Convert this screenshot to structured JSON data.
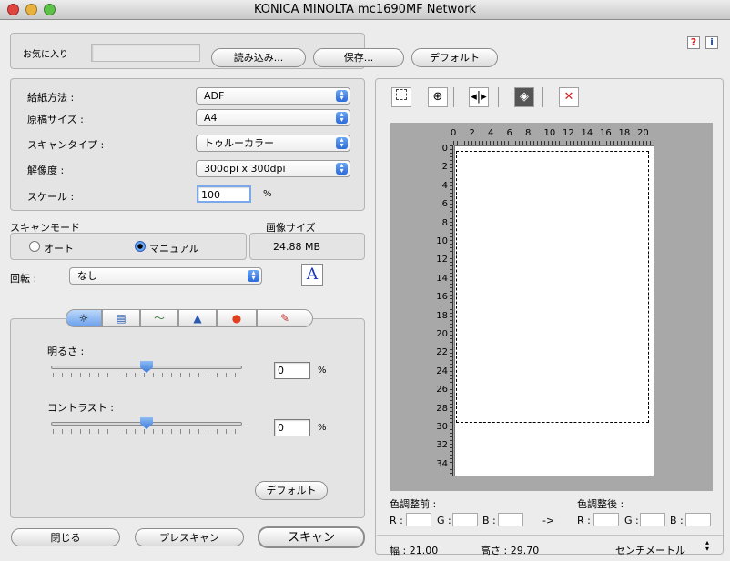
{
  "window": {
    "title": "KONICA MINOLTA mc1690MF Network"
  },
  "favorites": {
    "label": "お気に入り",
    "value": "",
    "load_label": "読み込み...",
    "save_label": "保存...",
    "default_label": "デフォルト"
  },
  "help": {
    "question": "?",
    "info": "i"
  },
  "settings": {
    "paper_feed": {
      "label": "給紙方法 :",
      "value": "ADF"
    },
    "doc_size": {
      "label": "原稿サイズ :",
      "value": "A4"
    },
    "scan_type": {
      "label": "スキャンタイプ :",
      "value": "トゥルーカラー"
    },
    "resolution": {
      "label": "解像度 :",
      "value": "300dpi x 300dpi"
    },
    "scale": {
      "label": "スケール :",
      "value": "100",
      "unit": "%"
    }
  },
  "scan_mode": {
    "label": "スキャンモード",
    "auto": "オート",
    "manual": "マニュアル",
    "selected": "manual"
  },
  "image_size": {
    "label": "画像サイズ",
    "value": "24.88 MB"
  },
  "rotation": {
    "label": "回転 :",
    "value": "なし",
    "preview_glyph": "A"
  },
  "adjust": {
    "brightness": {
      "label": "明るさ :",
      "value": "0",
      "unit": "%",
      "level": 0.5
    },
    "contrast": {
      "label": "コントラスト :",
      "value": "0",
      "unit": "%",
      "level": 0.5
    },
    "default_label": "デフォルト"
  },
  "footer": {
    "close": "閉じる",
    "prescan": "プレスキャン",
    "scan": "スキャン"
  },
  "preview": {
    "ruler_top": [
      "0",
      "2",
      "4",
      "6",
      "8",
      "10",
      "12",
      "14",
      "16",
      "18",
      "20"
    ],
    "ruler_left": [
      "0",
      "2",
      "4",
      "6",
      "8",
      "10",
      "12",
      "14",
      "16",
      "18",
      "20",
      "22",
      "24",
      "26",
      "28",
      "30",
      "32",
      "34"
    ]
  },
  "color_info": {
    "before_label": "色調整前 :",
    "after_label": "色調整後 :",
    "r": "R :",
    "g": "G :",
    "b": "B :",
    "arrow": "->"
  },
  "dimensions": {
    "width_label": "幅 : 21.00",
    "height_label": "高さ : 29.70",
    "unit": "センチメートル"
  }
}
